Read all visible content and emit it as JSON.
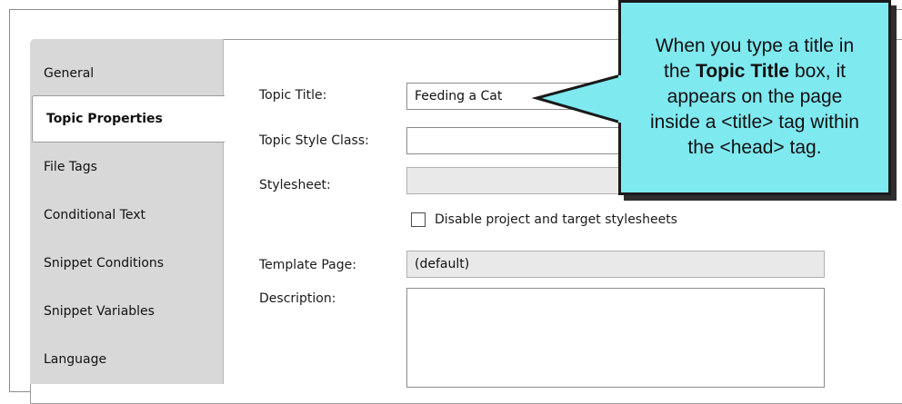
{
  "sidebar": {
    "items": [
      {
        "label": "General",
        "active": false
      },
      {
        "label": "Topic Properties",
        "active": true
      },
      {
        "label": "File Tags",
        "active": false
      },
      {
        "label": "Conditional Text",
        "active": false
      },
      {
        "label": "Snippet Conditions",
        "active": false
      },
      {
        "label": "Snippet Variables",
        "active": false
      },
      {
        "label": "Language",
        "active": false
      }
    ]
  },
  "form": {
    "topic_title_label": "Topic Title:",
    "topic_title_value": "Feeding a Cat",
    "style_class_label": "Topic Style Class:",
    "style_class_value": "",
    "stylesheet_label": "Stylesheet:",
    "stylesheet_value": "",
    "disable_stylesheets_label": "Disable project and target stylesheets",
    "disable_stylesheets_checked": false,
    "template_page_label": "Template Page:",
    "template_page_value": "(default)",
    "description_label": "Description:",
    "description_value": ""
  },
  "callout": {
    "line1": "When you type a title in",
    "line2_prefix": "the ",
    "line2_bold": "Topic Title",
    "line2_suffix": " box, it",
    "line3": "appears on the page",
    "line4": "inside a <title> tag within",
    "line5": "the <head> tag.",
    "background_color": "#7fe9f0"
  }
}
